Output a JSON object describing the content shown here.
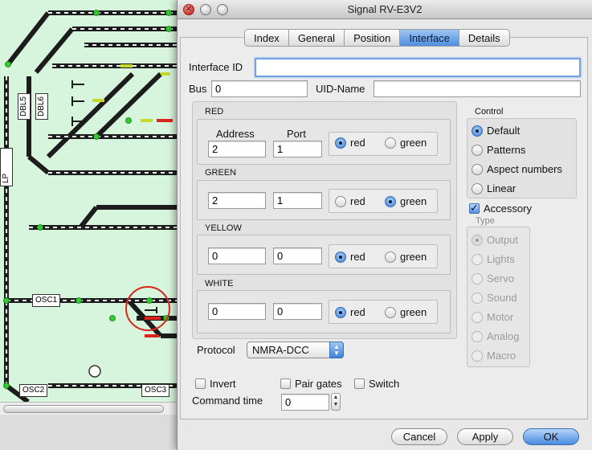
{
  "window": {
    "title": "Signal RV-E3V2"
  },
  "tabs": [
    {
      "label": "Index",
      "active": false
    },
    {
      "label": "General",
      "active": false
    },
    {
      "label": "Position",
      "active": false
    },
    {
      "label": "Interface",
      "active": true
    },
    {
      "label": "Details",
      "active": false
    }
  ],
  "interface": {
    "interface_id_label": "Interface ID",
    "interface_id_value": "",
    "bus_label": "Bus",
    "bus_value": "0",
    "uid_label": "UID-Name",
    "uid_value": ""
  },
  "colors": [
    {
      "title": "RED",
      "address_label": "Address",
      "port_label": "Port",
      "address": "2",
      "port": "1",
      "selected": "red"
    },
    {
      "title": "GREEN",
      "address": "2",
      "port": "1",
      "selected": "green"
    },
    {
      "title": "YELLOW",
      "address": "0",
      "port": "0",
      "selected": "red"
    },
    {
      "title": "WHITE",
      "address": "0",
      "port": "0",
      "selected": "red"
    }
  ],
  "radio_labels": {
    "red": "red",
    "green": "green"
  },
  "control": {
    "title": "Control",
    "options": [
      {
        "label": "Default",
        "selected": true
      },
      {
        "label": "Patterns",
        "selected": false
      },
      {
        "label": "Aspect numbers",
        "selected": false
      },
      {
        "label": "Linear",
        "selected": false
      }
    ],
    "accessory_label": "Accessory",
    "accessory_checked": true
  },
  "type": {
    "title": "Type",
    "options": [
      {
        "label": "Output",
        "selected": true
      },
      {
        "label": "Lights",
        "selected": false
      },
      {
        "label": "Servo",
        "selected": false
      },
      {
        "label": "Sound",
        "selected": false
      },
      {
        "label": "Motor",
        "selected": false
      },
      {
        "label": "Analog",
        "selected": false
      },
      {
        "label": "Macro",
        "selected": false
      }
    ]
  },
  "protocol": {
    "label": "Protocol",
    "value": "NMRA-DCC"
  },
  "options": {
    "invert_label": "Invert",
    "invert": false,
    "pair_gates_label": "Pair gates",
    "pair_gates": false,
    "switch_label": "Switch",
    "switch": false
  },
  "command_time": {
    "label": "Command time",
    "value": "0"
  },
  "buttons": {
    "cancel": "Cancel",
    "apply": "Apply",
    "ok": "OK"
  },
  "plan": {
    "labels": {
      "dbl5": "DBL5",
      "dbl6": "DBL6",
      "lp": "LP",
      "osc1": "OSC1",
      "osc2": "OSC2",
      "osc3": "OSC3"
    },
    "colors": {
      "background": "#d7f4dc",
      "track": "#1c1c1c",
      "signal_green": "#2ecc2e",
      "highlight_circle": "#d9261c"
    }
  }
}
